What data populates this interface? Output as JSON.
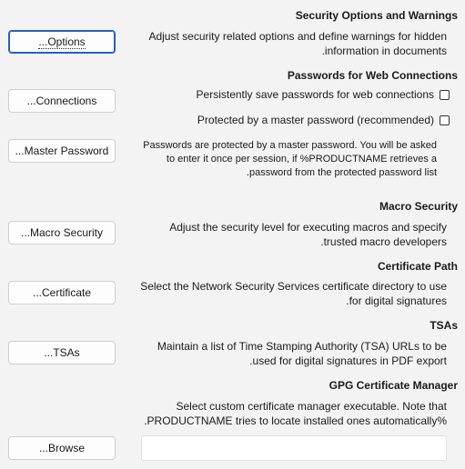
{
  "security_options": {
    "heading": "Security Options and Warnings",
    "button_label": "...Options",
    "desc_line1": "Adjust security related options and define warnings for hidden",
    "desc_line2": ".information in documents"
  },
  "passwords": {
    "heading": "Passwords for Web Connections",
    "persist_label": "Persistently save passwords for web connections",
    "persist_checked": false,
    "master_label": "Protected by a master password (recommended)",
    "master_checked": false,
    "connections_button": "...Connections",
    "master_button": "...Master Password",
    "desc_line1": "Passwords are protected by a master password. You will be asked",
    "desc_line2": "to enter it once per session, if %PRODUCTNAME retrieves a",
    "desc_line3": ".password from the protected password list"
  },
  "macro": {
    "heading": "Macro Security",
    "button_label": "...Macro Security",
    "desc_line1": "Adjust the security level for executing macros and specify",
    "desc_line2": ".trusted macro developers"
  },
  "certificate": {
    "heading": "Certificate Path",
    "button_label": "...Certificate",
    "desc_line1": "Select the Network Security Services certificate directory to use",
    "desc_line2": ".for digital signatures"
  },
  "tsas": {
    "heading": "TSAs",
    "button_label": "...TSAs",
    "desc_line1": "Maintain a list of Time Stamping Authority (TSA) URLs to be",
    "desc_line2": ".used for digital signatures in PDF export"
  },
  "gpg": {
    "heading": "GPG Certificate Manager",
    "desc_line1": "Select custom certificate manager executable. Note that",
    "desc_line2": ".PRODUCTNAME tries to locate installed ones automatically%",
    "browse_button": "...Browse",
    "path_value": ""
  }
}
